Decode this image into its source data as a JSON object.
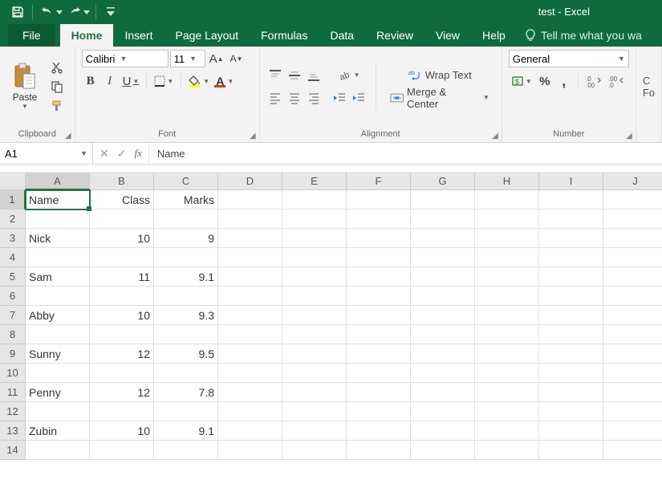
{
  "app": {
    "title": "test  -  Excel"
  },
  "tabs": {
    "file": "File",
    "items": [
      "Home",
      "Insert",
      "Page Layout",
      "Formulas",
      "Data",
      "Review",
      "View",
      "Help"
    ],
    "active": 0,
    "tellme": "Tell me what you wa"
  },
  "ribbon": {
    "clipboard": {
      "label": "Clipboard",
      "paste": "Paste"
    },
    "font": {
      "label": "Font",
      "name": "Calibri",
      "size": "11",
      "bold": "B",
      "italic": "I",
      "underline": "U"
    },
    "alignment": {
      "label": "Alignment",
      "wrap": "Wrap Text",
      "merge": "Merge & Center"
    },
    "number": {
      "label": "Number",
      "format": "General",
      "percent": "%",
      "comma": ","
    },
    "cells_trailing": "C\nFo"
  },
  "formula_bar": {
    "name_box": "A1",
    "fx": "fx",
    "content": "Name"
  },
  "columns": [
    "A",
    "B",
    "C",
    "D",
    "E",
    "F",
    "G",
    "H",
    "I",
    "J"
  ],
  "rows": [
    1,
    2,
    3,
    4,
    5,
    6,
    7,
    8,
    9,
    10,
    11,
    12,
    13,
    14
  ],
  "active_cell": "A1",
  "sheet": {
    "A1": "Name",
    "B1": "Class",
    "C1": "Marks",
    "A3": "Nick",
    "B3": "10",
    "C3": "9",
    "A5": "Sam",
    "B5": "11",
    "C5": "9.1",
    "A7": "Abby",
    "B7": "10",
    "C7": "9.3",
    "A9": "Sunny",
    "B9": "12",
    "C9": "9.5",
    "A11": "Penny",
    "B11": "12",
    "C11": "7.8",
    "A13": "Zubin",
    "B13": "10",
    "C13": "9.1"
  },
  "numeric_cols": [
    "B",
    "C"
  ]
}
